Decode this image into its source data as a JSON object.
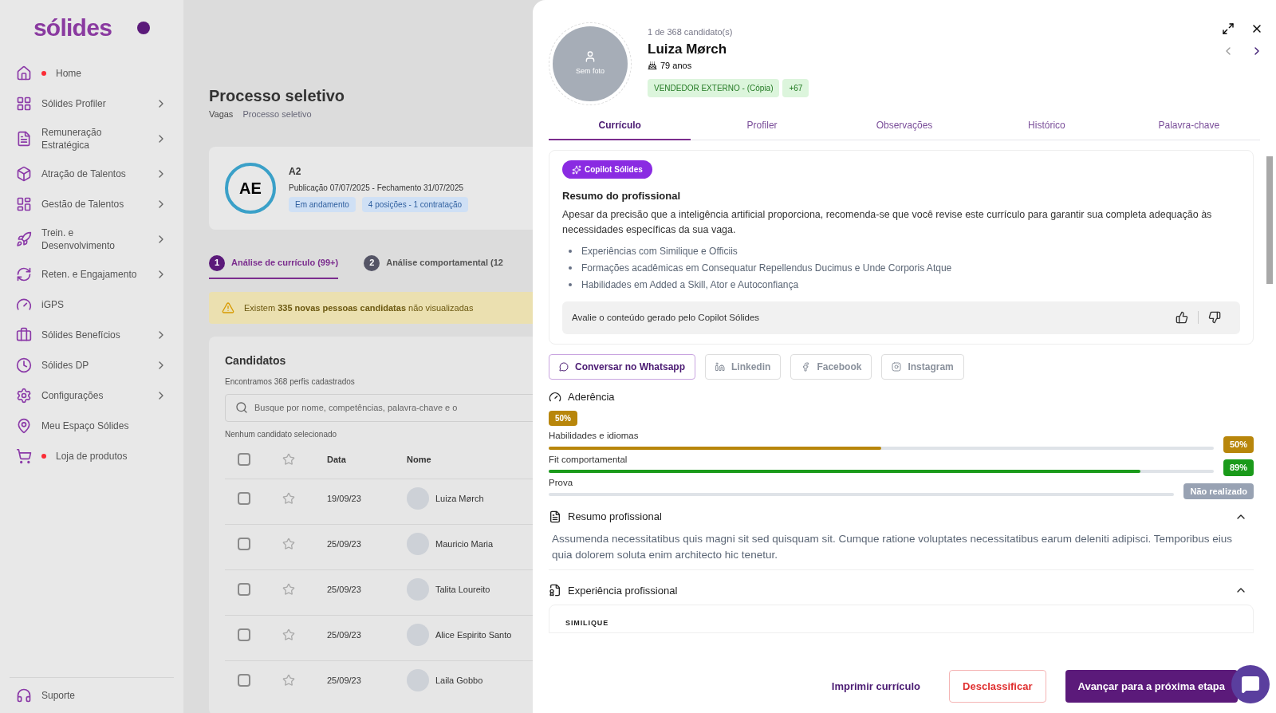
{
  "sidebar": {
    "logo": "sólides",
    "items": [
      {
        "label": "Home",
        "dot": true,
        "submenu": false
      },
      {
        "label": "Sólides Profiler",
        "dot": false,
        "submenu": true
      },
      {
        "label": "Remuneração Estratégica",
        "dot": false,
        "submenu": true
      },
      {
        "label": "Atração de Talentos",
        "dot": false,
        "submenu": true
      },
      {
        "label": "Gestão de Talentos",
        "dot": false,
        "submenu": true
      },
      {
        "label": "Trein. e Desenvolvimento",
        "dot": false,
        "submenu": true
      },
      {
        "label": "Reten. e Engajamento",
        "dot": false,
        "submenu": true
      },
      {
        "label": "iGPS",
        "dot": false,
        "submenu": false
      },
      {
        "label": "Sólides Benefícios",
        "dot": false,
        "submenu": true
      },
      {
        "label": "Sólides DP",
        "dot": false,
        "submenu": true
      },
      {
        "label": "Configurações",
        "dot": false,
        "submenu": true
      },
      {
        "label": "Meu Espaço Sólides",
        "dot": false,
        "submenu": false
      },
      {
        "label": "Loja de produtos",
        "dot": true,
        "submenu": false
      }
    ],
    "support": "Suporte"
  },
  "page": {
    "title": "Processo seletivo",
    "breadcrumb": [
      "Vagas",
      "Processo seletivo"
    ],
    "job": {
      "initials": "AE",
      "name": "A2",
      "dates": "Publicação 07/07/2025 - Fechamento 31/07/2025",
      "tags": [
        "Em andamento",
        "4 posições - 1 contratação"
      ]
    },
    "steps": [
      {
        "number": "1",
        "label": "Análise de currículo (99+)",
        "selected": true
      },
      {
        "number": "2",
        "label": "Análise comportamental (12",
        "selected": false
      }
    ],
    "alert": "Existem **335 novas pessoas candidatas** não visualizadas",
    "candidates": {
      "title": "Candidatos",
      "subtitle": "Encontramos 368 perfis cadastrados",
      "search_placeholder": "Busque por nome, competências, palavra-chave e o",
      "selection": "Nenhum candidato selecionado",
      "all_checked": false,
      "columns": [
        "Data",
        "Nome"
      ],
      "rows": [
        {
          "date": "19/09/23",
          "name": "Luiza Mørch",
          "checked": false,
          "starred": false
        },
        {
          "date": "25/09/23",
          "name": "Mauricio Maria",
          "checked": false,
          "starred": false
        },
        {
          "date": "25/09/23",
          "name": "Talita Loureito",
          "checked": false,
          "starred": false
        },
        {
          "date": "25/09/23",
          "name": "Alice Espirito Santo",
          "checked": false,
          "starred": false
        },
        {
          "date": "25/09/23",
          "name": "Laila Gobbo",
          "checked": false,
          "starred": false
        }
      ]
    }
  },
  "drawer": {
    "position": "1 de 368 candidato(s)",
    "name": "Luiza Mørch",
    "age": "79 anos",
    "photo_label": "Sem foto",
    "tags": [
      "VENDEDOR EXTERNO - (Cópia)",
      "+67"
    ],
    "tabs": [
      {
        "label": "Currículo",
        "selected": true
      },
      {
        "label": "Profiler",
        "selected": false
      },
      {
        "label": "Observações",
        "selected": false
      },
      {
        "label": "Histórico",
        "selected": false
      },
      {
        "label": "Palavra-chave",
        "selected": false
      }
    ],
    "copilot": {
      "badge": "Copilot Sólides",
      "title": "Resumo do profissional",
      "text": "Apesar da precisão que a inteligência artificial proporciona, recomenda-se que você revise este currículo para garantir sua completa adequação às necessidades específicas da sua vaga.",
      "bullets": [
        "Experiências com Similique e Officiis",
        "Formações acadêmicas em Consequatur Repellendus Ducimus e Unde Corporis Atque",
        "Habilidades em Added a Skill, Ator e Autoconfiança"
      ],
      "feedback": "Avalie o conteúdo gerado pelo Copilot Sólides"
    },
    "social": [
      {
        "kind": "whatsapp",
        "label": "Conversar no Whatsapp",
        "disabled": false
      },
      {
        "kind": "linkedin",
        "label": "Linkedin",
        "disabled": true
      },
      {
        "kind": "facebook",
        "label": "Facebook",
        "disabled": true
      },
      {
        "kind": "instagram",
        "label": "Instagram",
        "disabled": true
      }
    ],
    "adherence": {
      "title": "Aderência",
      "overall": "50%",
      "color": "#b8860b",
      "metrics": [
        {
          "label": "Habilidades e idiomas",
          "level": 0.5,
          "reading": "50%",
          "color": "#b8860b"
        },
        {
          "label": "Fit comportamental",
          "level": 0.89,
          "reading": "89%",
          "color": "#1a9a1a"
        },
        {
          "label": "Prova",
          "level": 0,
          "reading": "Não realizado",
          "color": "#98a2b3"
        }
      ]
    },
    "sections": [
      {
        "kind": "summary",
        "title": "Resumo profissional",
        "expanded": true,
        "text": "Assumenda necessitatibus quis magni sit sed quisquam sit. Cumque ratione voluptates necessitatibus earum deleniti adipisci. Temporibus eius quia dolorem soluta enim architecto hic tenetur."
      },
      {
        "kind": "experience",
        "title": "Experiência profissional",
        "expanded": true,
        "entries": [
          "SIMILIQUE"
        ]
      }
    ],
    "footer": {
      "print": "Imprimir currículo",
      "disqualify": "Desclassificar",
      "advance": "Avançar para a próxima etapa"
    }
  }
}
